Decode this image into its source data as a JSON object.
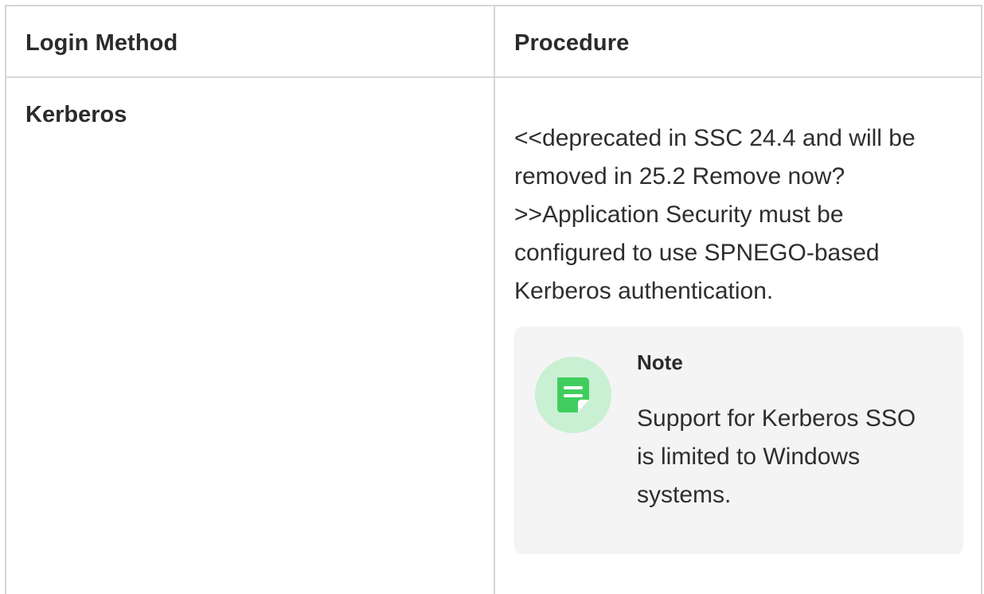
{
  "table": {
    "headers": {
      "login_method": "Login Method",
      "procedure": "Procedure"
    },
    "rows": [
      {
        "login_method": "Kerberos",
        "procedure": "<<deprecated in SSC 24.4 and will be removed in 25.2 Remove now? >>Application Security must be configured to use SPNEGO-based Kerberos authentication.",
        "note": {
          "icon": "note-icon",
          "title": "Note",
          "text": "Support for Kerberos SSO is limited to Windows systems."
        }
      }
    ]
  },
  "colors": {
    "border": "#d6d6d6",
    "note_background": "#f4f4f4",
    "note_icon_circle": "#c9f0d3",
    "note_icon_fill": "#3fce5e"
  }
}
